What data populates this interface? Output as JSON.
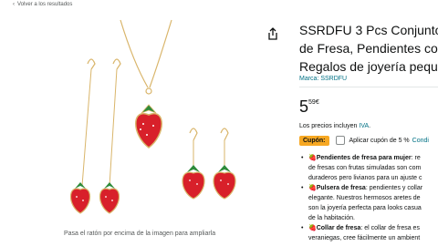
{
  "nav": {
    "back_label": "Volver a los resultados"
  },
  "gallery": {
    "hint": "Pasa el ratón por encima de la imagen para ampliarla"
  },
  "product": {
    "title_lines": [
      "SSRDFU 3 Pcs Conjunto d",
      "de Fresa, Pendientes con",
      "Regalos de joyería peque"
    ],
    "brand": "Marca: SSRDFU",
    "price_whole": "5",
    "price_fraction": "59",
    "currency": "€",
    "taxes_prefix": "Los precios incluyen ",
    "taxes_link": "IVA",
    "taxes_suffix": ".",
    "coupon_badge": "Cupón:",
    "coupon_text": "Aplicar cupón de 5 %",
    "coupon_link": "Condi"
  },
  "features": [
    {
      "bold": "Pendientes de fresa para mujer",
      "line1": ": re",
      "line2": "de fresas con frutas simuladas son com",
      "line3": "duraderos pero livianos para un ajuste c"
    },
    {
      "bold": "Pulsera de fresa",
      "line1": ": pendientes y collar",
      "line2": "elegante. Nuestros hermosos aretes de",
      "line3": "son la joyería perfecta para looks casua",
      "line4": "de la habitación."
    },
    {
      "bold": "Collar de fresa",
      "line1": ": el collar de fresa es",
      "line2": "veraniegas, cree fácilmente un ambient"
    }
  ],
  "colors": {
    "link": "#007185",
    "coupon_badge": "#f7a823",
    "strawberry": "#d8202a",
    "gold": "#d9b56a"
  },
  "icons": {
    "share": "share-icon",
    "strawberry": "strawberry-emoji"
  }
}
